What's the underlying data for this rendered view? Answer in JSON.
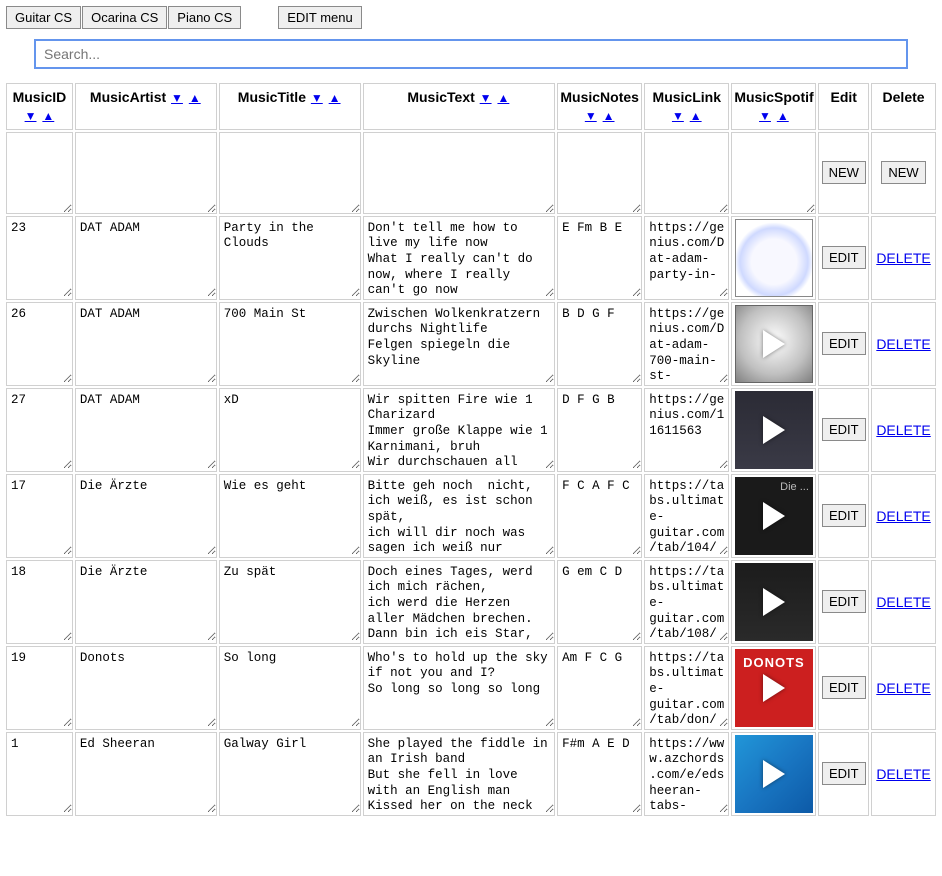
{
  "toolbar": {
    "guitar": "Guitar CS",
    "ocarina": "Ocarina CS",
    "piano": "Piano CS",
    "editmenu": "EDIT menu"
  },
  "search": {
    "placeholder": "Search..."
  },
  "columns": {
    "id": "MusicID",
    "artist": "MusicArtist",
    "title": "MusicTitle",
    "text": "MusicText",
    "notes": "MusicNotes",
    "link": "MusicLink",
    "spotify": "MusicSpotif",
    "edit": "Edit",
    "delete": "Delete"
  },
  "sort": {
    "down": "▼",
    "up": "▲"
  },
  "labels": {
    "new": "NEW",
    "edit": "EDIT",
    "delete": "DELETE"
  },
  "thumbStyles": [
    "background: radial-gradient(circle at 50% 55%, #f8f8ff 40%, #cfd9ff 60%, #fff 70%); border:1px solid #888;",
    "background: radial-gradient(circle at 50% 45%, #fff 0%, #c0c0c0 60%, #808080 100%); border:1px solid #666;",
    "background: linear-gradient(#2b2b35, #3a3a46); position:relative;",
    "background: #1a1a1a; color:#bbb; font-size:11px; justify-content:flex-end; align-items:flex-start; padding:4px;",
    "background: linear-gradient(#1c1c1c, #2a2a2a);",
    "background: #cc1f1f; color:#fff; font-weight:bold; font-size:13px; align-items:flex-start; padding-top:6px; letter-spacing:1px;",
    "background: linear-gradient(135deg, #2196d8 0%, #1976c2 50%, #0d5aa7 100%);"
  ],
  "thumbText": [
    "",
    "",
    "",
    "Die ...",
    "",
    "DONOTS",
    ""
  ],
  "rows": [
    {
      "id": "23",
      "artist": "DAT ADAM",
      "title": "Party in the Clouds",
      "text": "Don't tell me how to live my life now\nWhat I really can't do now, where I really can't go now",
      "notes": "E Fm B E",
      "link": "https://genius.com/Dat-adam-party-in-"
    },
    {
      "id": "26",
      "artist": "DAT ADAM",
      "title": "700 Main St",
      "text": "Zwischen Wolkenkratzern durchs Nightlife\nFelgen spiegeln die Skyline",
      "notes": "B D G F",
      "link": "https://genius.com/Dat-adam-700-main-st-"
    },
    {
      "id": "27",
      "artist": "DAT ADAM",
      "title": "xD",
      "text": "Wir spitten Fire wie 1 Charizard\nImmer große Klappe wie 1 Karnimani, bruh\nWir durchschauen all",
      "notes": "D F G B",
      "link": "https://genius.com/11611563"
    },
    {
      "id": "17",
      "artist": "Die Ärzte",
      "title": "Wie es geht",
      "text": "Bitte geh noch  nicht, ich weiß, es ist schon spät,\nich will dir noch was sagen ich weiß nur",
      "notes": "F C A F C",
      "link": "https://tabs.ultimate-guitar.com/tab/104/"
    },
    {
      "id": "18",
      "artist": "Die Ärzte",
      "title": "Zu spät",
      "text": "Doch eines Tages, werd ich mich rächen,\nich werd die Herzen aller Mädchen brechen.\nDann bin ich eis Star,",
      "notes": "G em C D",
      "link": "https://tabs.ultimate-guitar.com/tab/108/"
    },
    {
      "id": "19",
      "artist": "Donots",
      "title": "So long",
      "text": "Who's to hold up the sky\nif not you and I?\nSo long so long so long",
      "notes": "Am F C G",
      "link": "https://tabs.ultimate-guitar.com/tab/don/"
    },
    {
      "id": "1",
      "artist": "Ed Sheeran",
      "title": "Galway Girl",
      "text": "She played the fiddle in an Irish band\nBut she fell in love with an English man\nKissed her on the neck",
      "notes": "F#m A E D",
      "link": "https://www.azchords.com/e/edsheeran-tabs-"
    }
  ]
}
